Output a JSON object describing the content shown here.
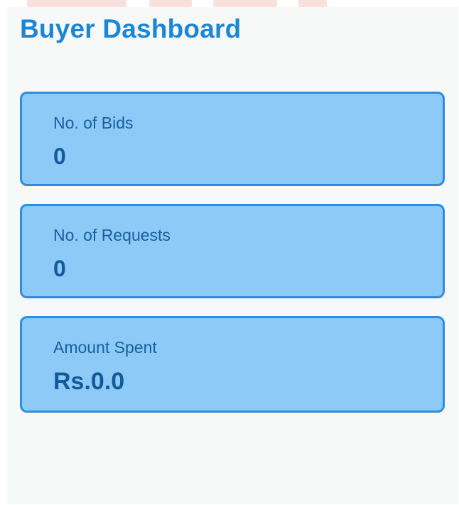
{
  "page": {
    "title": "Buyer Dashboard"
  },
  "cards": [
    {
      "label": "No. of Bids",
      "value": "0"
    },
    {
      "label": "No. of Requests",
      "value": "0"
    },
    {
      "label": "Amount Spent",
      "value": "Rs.0.0"
    }
  ],
  "colors": {
    "title": "#1c86d6",
    "card_fill": "#8ecaf7",
    "card_border": "#2d8de0",
    "card_text": "#1b5ea0",
    "panel_bg": "#f7f8f8"
  }
}
